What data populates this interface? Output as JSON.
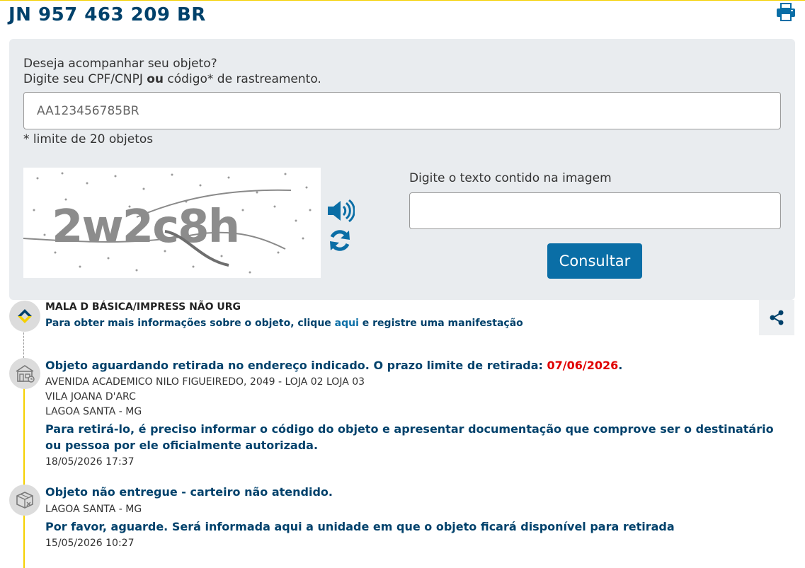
{
  "tracking_code": "JN 957 463 209 BR",
  "search": {
    "prompt_line1": "Deseja acompanhar seu objeto?",
    "prompt_line2_a": "Digite seu CPF/CNPJ ",
    "prompt_line2_or": "ou",
    "prompt_line2_b": " código* de rastreamento.",
    "code_placeholder": "AA123456785BR",
    "limit_note": "* limite de 20 objetos",
    "captcha_text": "2w2c8h",
    "captcha_label": "Digite o texto contido na imagem",
    "submit_label": "Consultar"
  },
  "service": {
    "name": "MALA D BÁSICA/IMPRESS NÃO URG",
    "info_before": "Para obter mais informações sobre o objeto, clique ",
    "info_link": "aqui",
    "info_after": " e registre uma manifestação"
  },
  "events": [
    {
      "title": "Objeto aguardando retirada no endereço indicado. O prazo limite de retirada: ",
      "deadline": "07/06/2026",
      "title_end": ".",
      "address_line1": "AVENIDA ACADEMICO NILO FIGUEIREDO, 2049 - LOJA 02 LOJA 03",
      "address_line2": "VILA JOANA D'ARC",
      "address_line3": "LAGOA SANTA - MG",
      "note": "Para retirá-lo, é preciso informar o código do objeto e apresentar documentação que comprove ser o destinatário ou pessoa por ele oficialmente autorizada.",
      "datetime": "18/05/2026 17:37"
    },
    {
      "title": "Objeto não entregue - carteiro não atendido.",
      "location": "LAGOA SANTA - MG",
      "note": "Por favor, aguarde. Será informada aqui a unidade em que o objeto ficará disponível para retirada",
      "datetime": "15/05/2026 10:27"
    }
  ],
  "colors": {
    "brand_blue": "#00416b",
    "button_blue": "#0a6ea6",
    "accent_yellow": "#f5d000",
    "deadline_red": "#e00000"
  }
}
